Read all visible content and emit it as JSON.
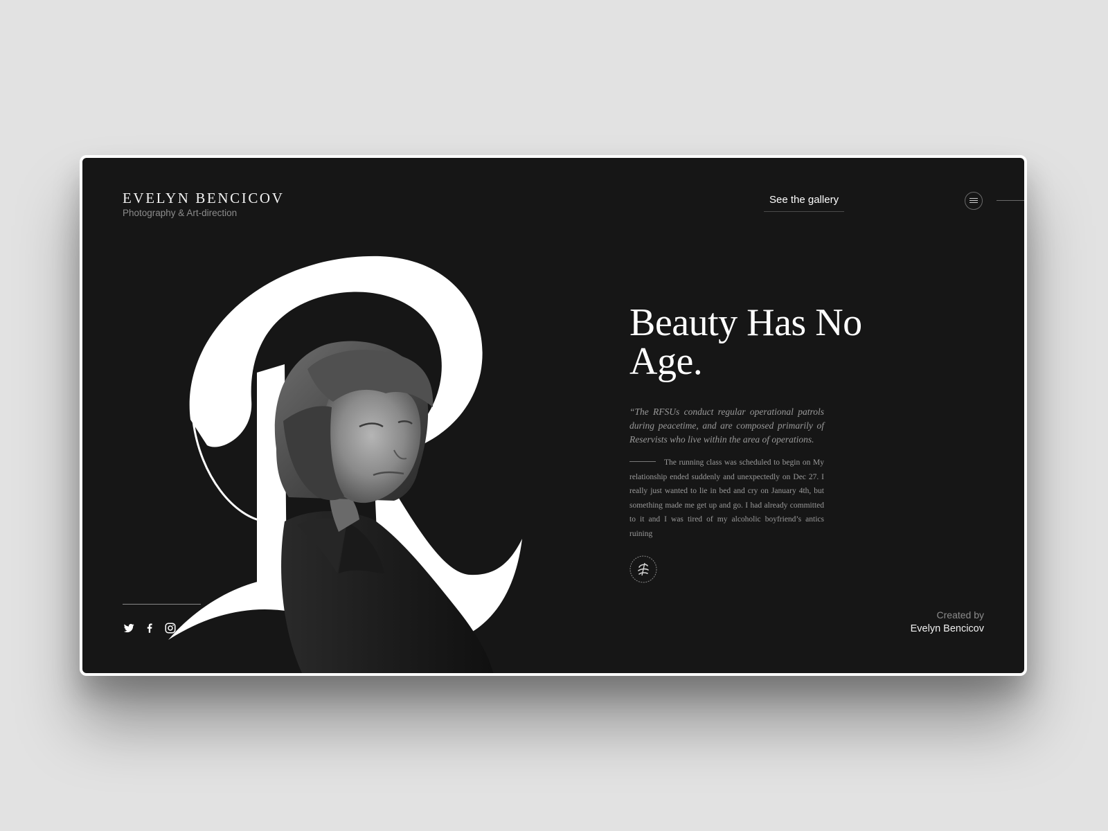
{
  "brand": {
    "name": "EVELYN BENCICOV",
    "subtitle": "Photography & Art-direction"
  },
  "nav": {
    "gallery_link": "See the gallery",
    "menu_icon": "hamburger-menu-icon"
  },
  "hero": {
    "headline": "Beauty Has No Age.",
    "quote": "“The RFSUs conduct regular operational patrols during peacetime, and are composed primarily of Reservists who live within the area of operations.",
    "body": "The running class was scheduled to begin on My relationship ended suddenly and unexpectedly on Dec 27. I really just wanted to lie in bed and cry on January 4th, but something made me get up and go. I had already committed to it and I was tired of my alcoholic boyfriend’s antics ruining",
    "badge_icon": "signature-badge-icon",
    "portrait": "woman-portrait-with-letter-r"
  },
  "social": {
    "items": [
      {
        "icon": "twitter-icon"
      },
      {
        "icon": "facebook-icon"
      },
      {
        "icon": "instagram-icon"
      }
    ]
  },
  "credit": {
    "label": "Created by",
    "name": "Evelyn Bencicov"
  },
  "colors": {
    "page_background": "#e2e2e2",
    "frame_background": "#161616",
    "frame_border": "#ffffff",
    "text_primary": "#ffffff",
    "text_muted": "#9a9a9a"
  }
}
